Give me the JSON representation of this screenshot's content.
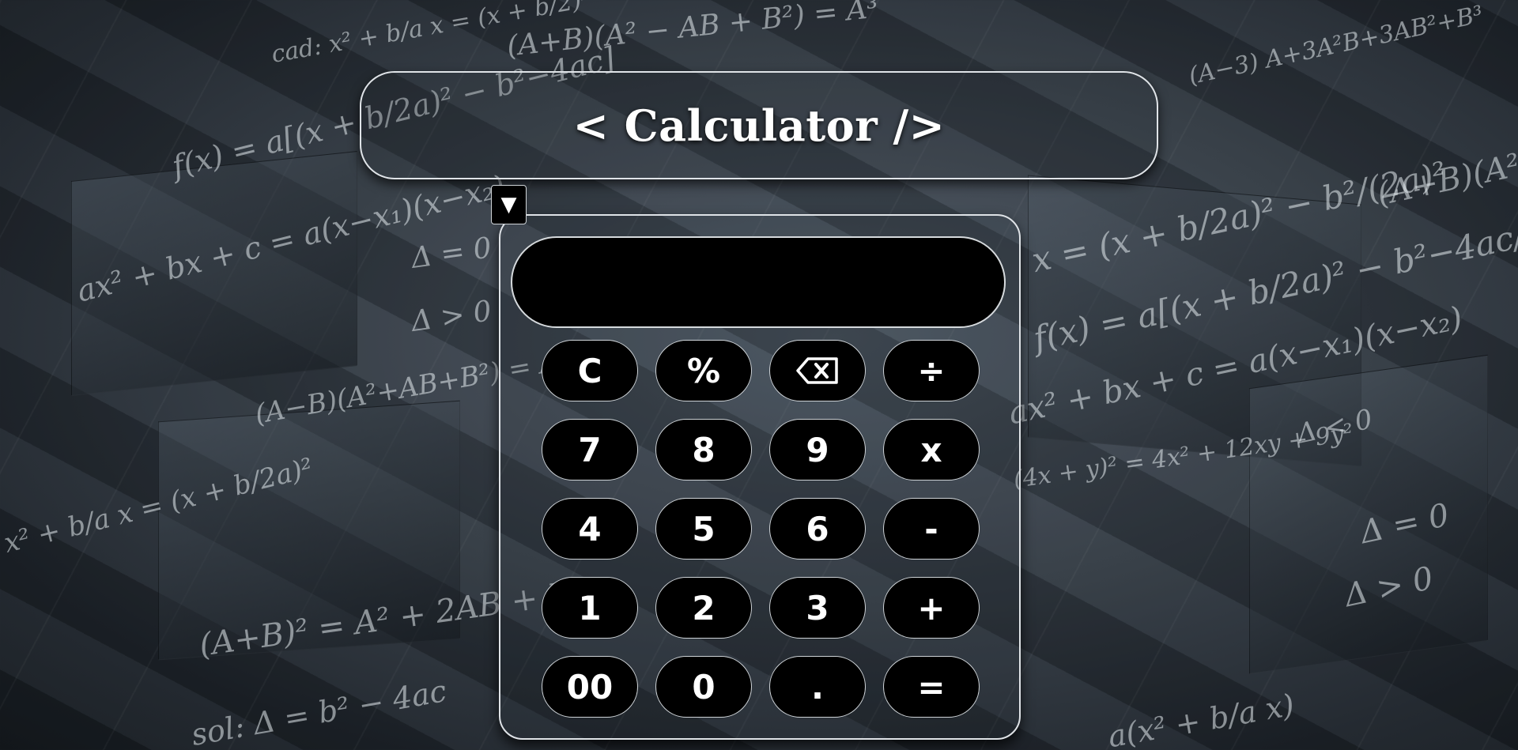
{
  "header": {
    "title": "< Calculator />"
  },
  "toggle": {
    "icon": "triangle-down-icon",
    "glyph": "▼"
  },
  "display": {
    "value": ""
  },
  "keys": [
    {
      "name": "clear-button",
      "label": "C"
    },
    {
      "name": "percent-button",
      "label": "%"
    },
    {
      "name": "backspace-button",
      "label": "",
      "icon": "backspace-icon"
    },
    {
      "name": "divide-button",
      "label": "÷"
    },
    {
      "name": "seven-button",
      "label": "7"
    },
    {
      "name": "eight-button",
      "label": "8"
    },
    {
      "name": "nine-button",
      "label": "9"
    },
    {
      "name": "multiply-button",
      "label": "x"
    },
    {
      "name": "four-button",
      "label": "4"
    },
    {
      "name": "five-button",
      "label": "5"
    },
    {
      "name": "six-button",
      "label": "6"
    },
    {
      "name": "subtract-button",
      "label": "-"
    },
    {
      "name": "one-button",
      "label": "1"
    },
    {
      "name": "two-button",
      "label": "2"
    },
    {
      "name": "three-button",
      "label": "3"
    },
    {
      "name": "add-button",
      "label": "+"
    },
    {
      "name": "double-zero-button",
      "label": "00"
    },
    {
      "name": "zero-button",
      "label": "0"
    },
    {
      "name": "decimal-button",
      "label": "."
    },
    {
      "name": "equals-button",
      "label": "="
    }
  ],
  "colors": {
    "key_background": "#000000",
    "key_text": "#ffffff",
    "border": "#dfe3e7"
  }
}
